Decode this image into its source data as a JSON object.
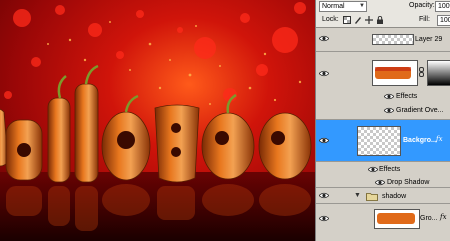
{
  "options_bar": {
    "blend_mode": "Normal",
    "opacity_label": "Opacity:",
    "opacity_value": "100%"
  },
  "lock_bar": {
    "lock_label": "Lock:",
    "fill_label": "Fill:",
    "fill_value": "100%",
    "lock_icons": [
      "lock-transparent-icon",
      "lock-paint-icon",
      "lock-move-icon",
      "lock-all-icon"
    ]
  },
  "layers": [
    {
      "name": "Layer 29"
    },
    {
      "name": "",
      "effects_label": "Effects",
      "effect": "Gradient Ove..."
    },
    {
      "name": "Backgro...",
      "fx": "fx",
      "selected": true,
      "effects_label": "Effects",
      "effect": "Drop Shadow"
    },
    {
      "name": "shadow",
      "type": "group"
    },
    {
      "name": "Gro...",
      "fx": "fx"
    }
  ],
  "colors": {
    "selection": "#3399ff",
    "panel": "#d4d0c8"
  },
  "artwork": {
    "letters": [
      "H",
      "a",
      "l",
      "l",
      "o",
      "w",
      "e",
      "e"
    ]
  }
}
